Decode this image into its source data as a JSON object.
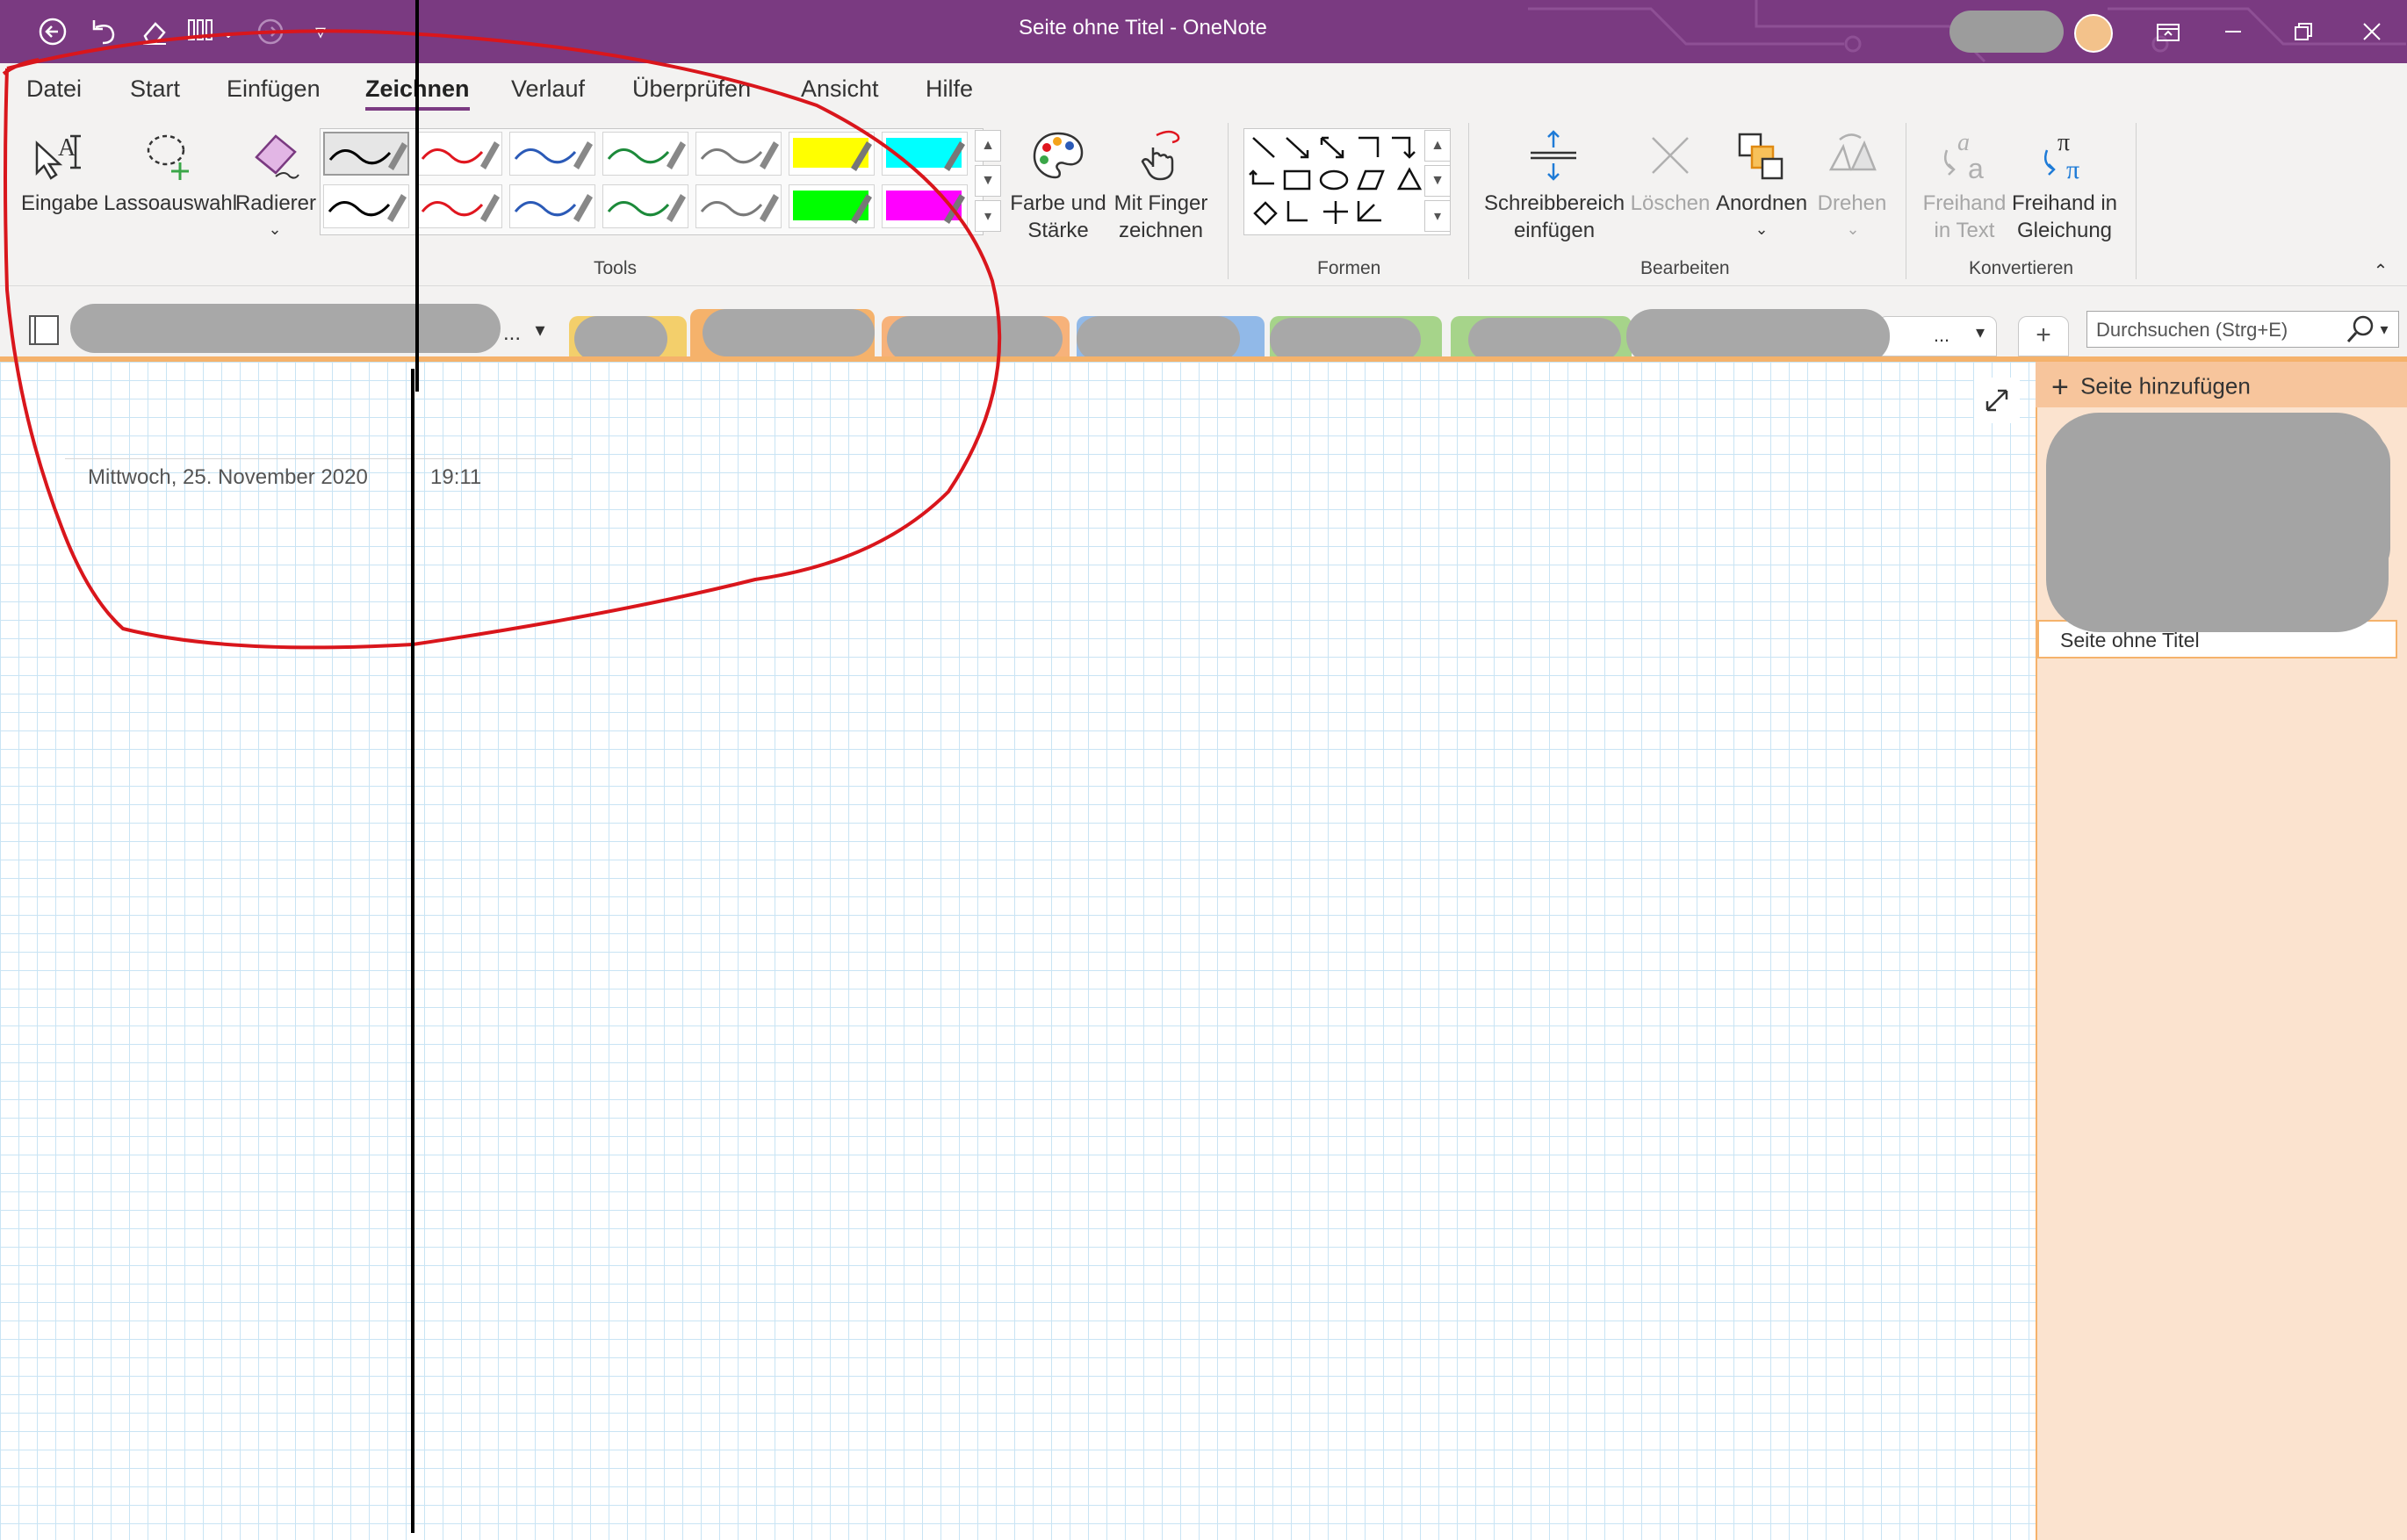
{
  "window": {
    "title": "Seite ohne Titel  -  OneNote",
    "app_color": "#7a3a81"
  },
  "qat": {
    "back_icon": "back-arrow-icon",
    "undo_icon": "undo-icon",
    "eraser_icon": "eraser-icon",
    "pens_icon": "pens-icon",
    "chevron": "⌄",
    "forward_icon": "forward-icon",
    "customize": "▿"
  },
  "menu": {
    "tabs": [
      "Datei",
      "Start",
      "Einfügen",
      "Zeichnen",
      "Verlauf",
      "Überprüfen",
      "Ansicht",
      "Hilfe"
    ],
    "active": "Zeichnen"
  },
  "ribbon": {
    "tools": {
      "eingabe": "Eingabe",
      "lasso": "Lassoauswahl",
      "radierer": "Radierer",
      "group": "Tools",
      "pen_colors_row1": [
        "#000000",
        "#e0161f",
        "#2b5ab7",
        "#1c8a3a",
        "#7a7a7a",
        "#ffff00",
        "#00ffff"
      ],
      "pen_colors_row2": [
        "#000000",
        "#e0161f",
        "#2b5ab7",
        "#1c8a3a",
        "#7a7a7a",
        "#00ff00",
        "#ff00ff"
      ]
    },
    "farbe": "Farbe und\nStärke",
    "finger": "Mit Finger\nzeichnen",
    "shapes_group": "Formen",
    "bearbeiten": {
      "schreib": "Schreibbereich\neinfügen",
      "loeschen": "Löschen",
      "anordnen": "Anordnen",
      "drehen": "Drehen",
      "group": "Bearbeiten"
    },
    "konvertieren": {
      "text": "Freihand\nin Text",
      "gleichung": "Freihand in\nGleichung",
      "group": "Konvertieren"
    }
  },
  "notebook": {
    "more": "...",
    "sections_more": "...",
    "add_section": "+"
  },
  "search": {
    "placeholder": "Durchsuchen (Strg+E)"
  },
  "page": {
    "date": "Mittwoch, 25. November 2020",
    "time": "19:11"
  },
  "pages_pane": {
    "add_page": "Seite hinzufügen",
    "current_page": "Seite ohne Titel"
  }
}
